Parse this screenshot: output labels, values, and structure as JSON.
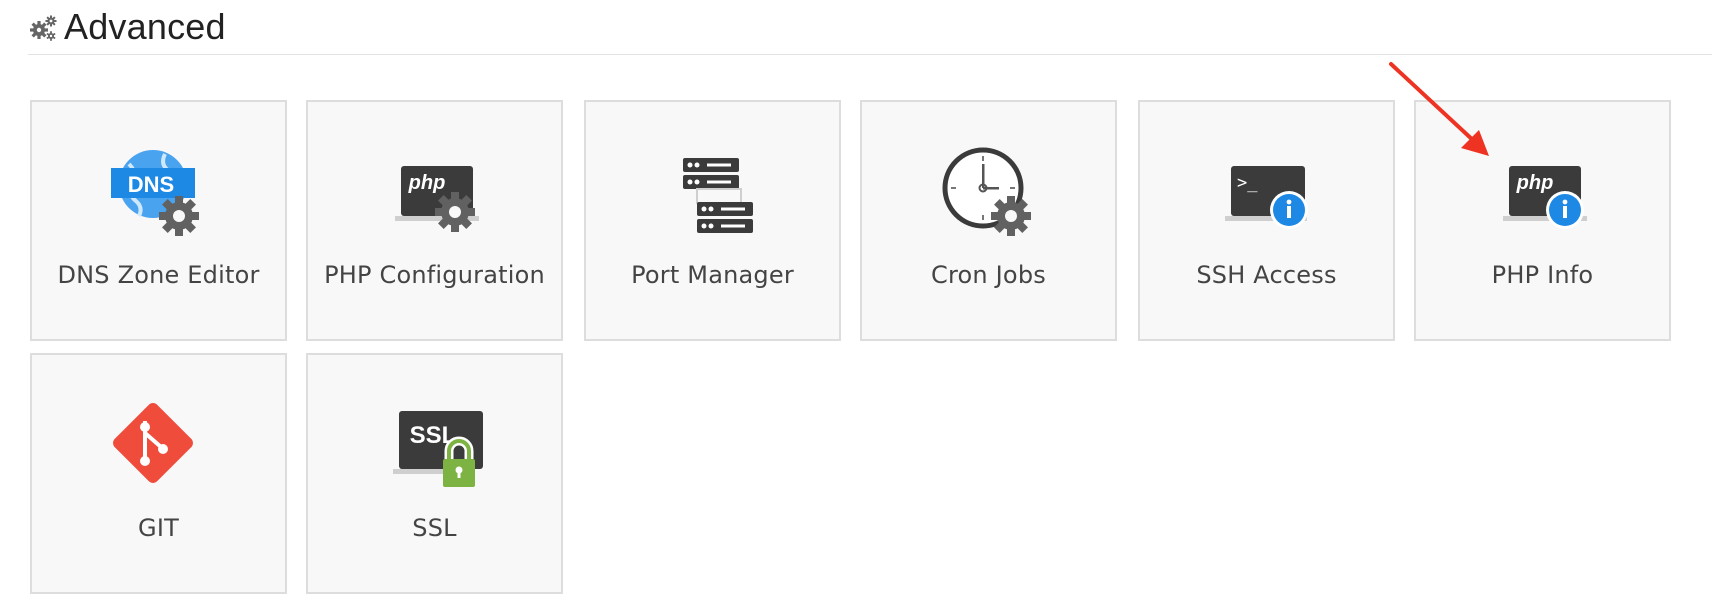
{
  "section": {
    "title": "Advanced",
    "icon": "gears-icon"
  },
  "tiles": [
    {
      "label": "DNS Zone Editor",
      "icon": "dns-zone-editor-icon",
      "icon_text": "DNS"
    },
    {
      "label": "PHP Configuration",
      "icon": "php-configuration-icon",
      "icon_text": "php"
    },
    {
      "label": "Port Manager",
      "icon": "port-manager-icon"
    },
    {
      "label": "Cron Jobs",
      "icon": "cron-jobs-icon"
    },
    {
      "label": "SSH Access",
      "icon": "ssh-access-icon",
      "icon_text": ">_"
    },
    {
      "label": "PHP Info",
      "icon": "php-info-icon",
      "icon_text": "php"
    },
    {
      "label": "GIT",
      "icon": "git-icon"
    },
    {
      "label": "SSL",
      "icon": "ssl-icon",
      "icon_text": "SSL"
    }
  ],
  "colors": {
    "tile_bg": "#f8f8f8",
    "tile_border": "#dddddd",
    "monitor_dark": "#3b3b3b",
    "gear_gray": "#616161",
    "dns_blue": "#1e88e5",
    "info_blue": "#1e88e5",
    "git_red": "#ef4c3c",
    "lock_green": "#7cb342",
    "annotation_arrow": "#ee3322"
  }
}
